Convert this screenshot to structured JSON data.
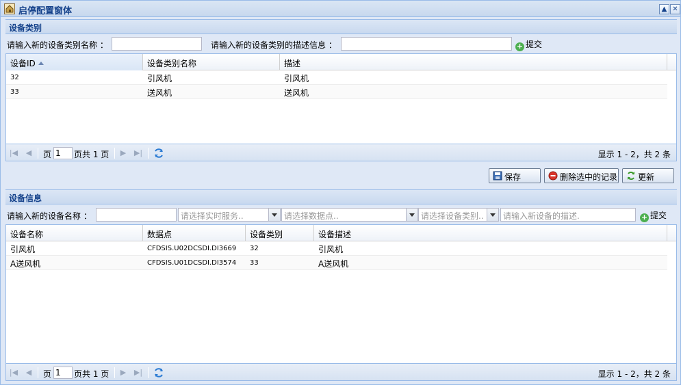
{
  "window": {
    "title": "启停配置窗体",
    "icon": "home-icon"
  },
  "category_panel": {
    "title": "设备类别",
    "name_label": "请输入新的设备类别名称 ：",
    "name_value": "",
    "desc_label": "请输入新的设备类别的描述信息 ：",
    "desc_value": "",
    "submit_label": "提交",
    "columns": [
      "设备ID",
      "设备类别名称",
      "描述"
    ],
    "rows": [
      {
        "id": "32",
        "name": "引风机",
        "desc": "引风机"
      },
      {
        "id": "33",
        "name": "送风机",
        "desc": "送风机"
      }
    ],
    "pager": {
      "page_label": "页",
      "page_value": "1",
      "total_label": "页共  1 页",
      "display": "显示 1 - 2，共 2 条"
    }
  },
  "actions": {
    "save_label": "保存",
    "delete_label": "删除选中的记录",
    "refresh_label": "更新"
  },
  "device_panel": {
    "title": "设备信息",
    "name_label": "请输入新的设备名称 ：",
    "name_value": "",
    "service_placeholder": "请选择实时服务..",
    "point_placeholder": "请选择数据点..",
    "category_placeholder": "请选择设备类别..",
    "desc_placeholder": "请输入新设备的描述.",
    "submit_label": "提交",
    "columns": [
      "设备名称",
      "数据点",
      "设备类别",
      "设备描述"
    ],
    "rows": [
      {
        "name": "引风机",
        "point": "CFDSIS.U02DCSDI.DI3669",
        "category": "32",
        "desc": "引风机"
      },
      {
        "name": "A送风机",
        "point": "CFDSIS.U01DCSDI.DI3574",
        "category": "33",
        "desc": "A送风机"
      }
    ],
    "pager": {
      "page_label": "页",
      "page_value": "1",
      "total_label": "页共  1 页",
      "display": "显示 1 - 2，共 2 条"
    }
  },
  "colors": {
    "header_text": "#15428b",
    "border": "#99bbe8",
    "panel_bg": "#dfe8f6"
  }
}
